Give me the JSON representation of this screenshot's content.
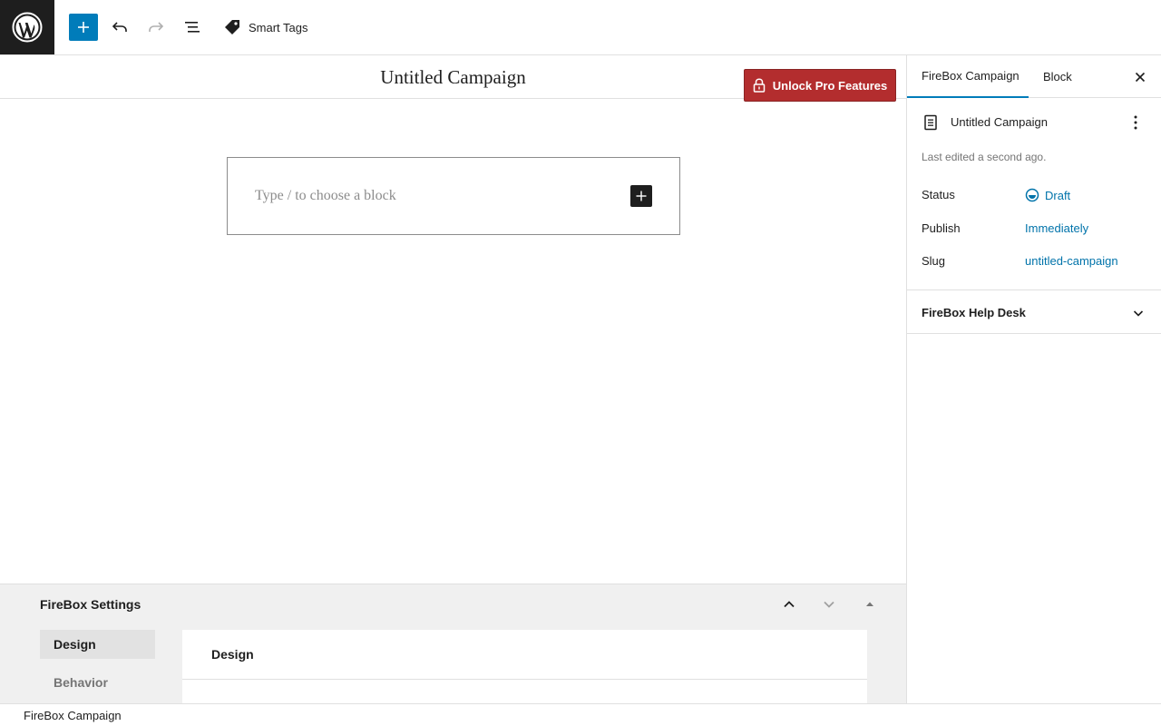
{
  "toolbar": {
    "logo_icon": "wordpress-icon",
    "smart_tags_label": "Smart Tags"
  },
  "editor": {
    "title": "Untitled Campaign",
    "unlock_label": "Unlock Pro Features",
    "block_placeholder": "Type / to choose a block"
  },
  "meta_box": {
    "title": "FireBox Settings",
    "nav": [
      "Design",
      "Behavior"
    ],
    "panel_title": "Design"
  },
  "sidebar": {
    "tabs": [
      "FireBox Campaign",
      "Block"
    ],
    "doc_title": "Untitled Campaign",
    "last_edited": "Last edited a second ago.",
    "rows": [
      {
        "label": "Status",
        "value": "Draft"
      },
      {
        "label": "Publish",
        "value": "Immediately"
      },
      {
        "label": "Slug",
        "value": "untitled-campaign"
      }
    ],
    "help_desk": "FireBox Help Desk"
  },
  "footer": {
    "breadcrumb": "FireBox Campaign"
  },
  "colors": {
    "accent": "#007cba",
    "danger": "#b32d2e",
    "link": "#0073aa"
  }
}
